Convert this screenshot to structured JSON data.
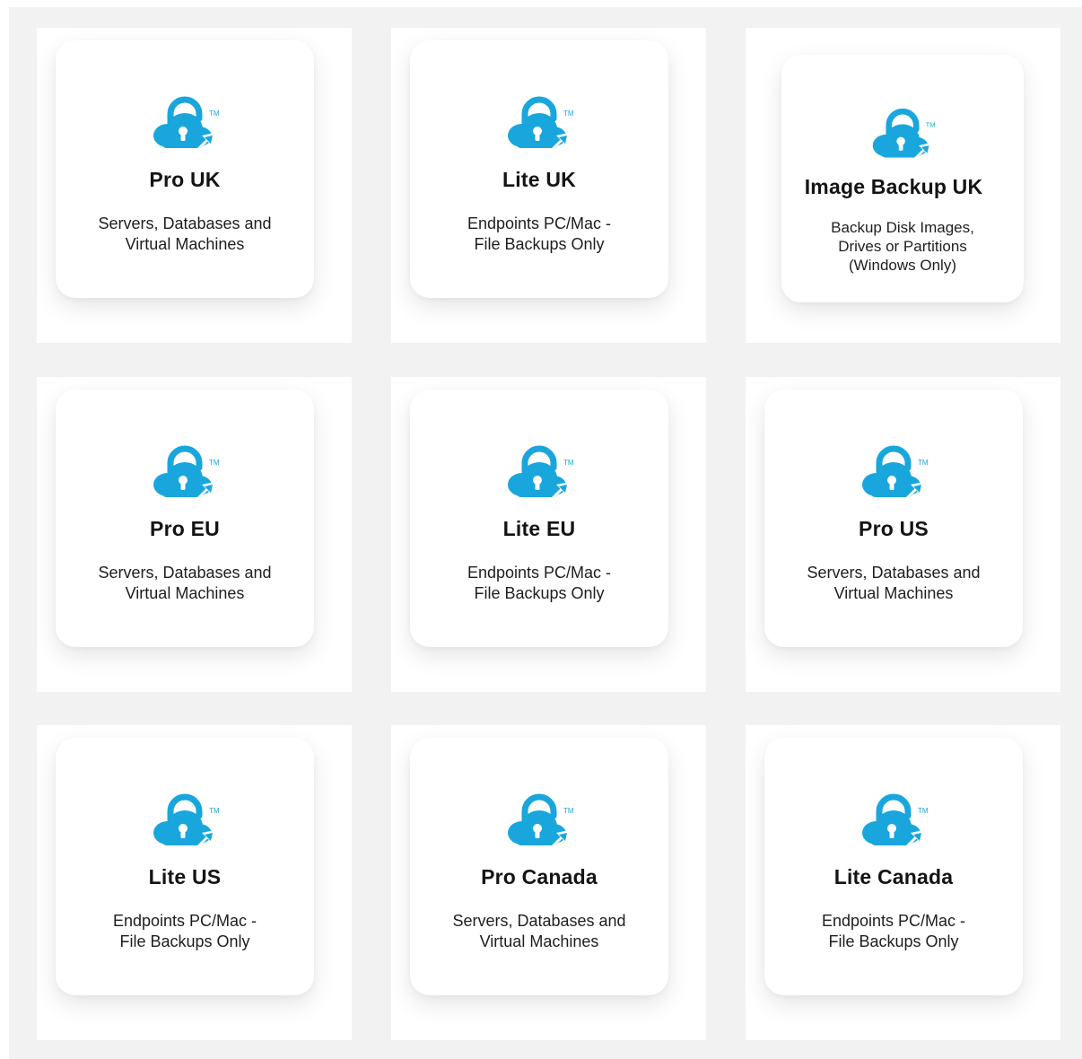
{
  "colors": {
    "accent": "#18a6dd",
    "stage_background": "#f2f2f2",
    "card_background": "#ffffff",
    "title_text": "#141414"
  },
  "logo": {
    "icon": "cloud-lock-upload-icon",
    "trademark": "TM"
  },
  "plans": [
    {
      "title": "Pro UK",
      "description": "Servers, Databases and\nVirtual Machines"
    },
    {
      "title": "Lite UK",
      "description": "Endpoints PC/Mac -\nFile Backups Only"
    },
    {
      "title": "Image Backup UK",
      "description": "Backup Disk Images,\nDrives or Partitions\n(Windows Only)"
    },
    {
      "title": "Pro EU",
      "description": "Servers, Databases and\nVirtual Machines"
    },
    {
      "title": "Lite EU",
      "description": "Endpoints PC/Mac -\nFile Backups Only"
    },
    {
      "title": "Pro US",
      "description": "Servers, Databases and\nVirtual Machines"
    },
    {
      "title": "Lite US",
      "description": "Endpoints PC/Mac -\nFile Backups Only"
    },
    {
      "title": "Pro Canada",
      "description": "Servers, Databases and\nVirtual Machines"
    },
    {
      "title": "Lite Canada",
      "description": "Endpoints PC/Mac -\nFile Backups Only"
    }
  ]
}
